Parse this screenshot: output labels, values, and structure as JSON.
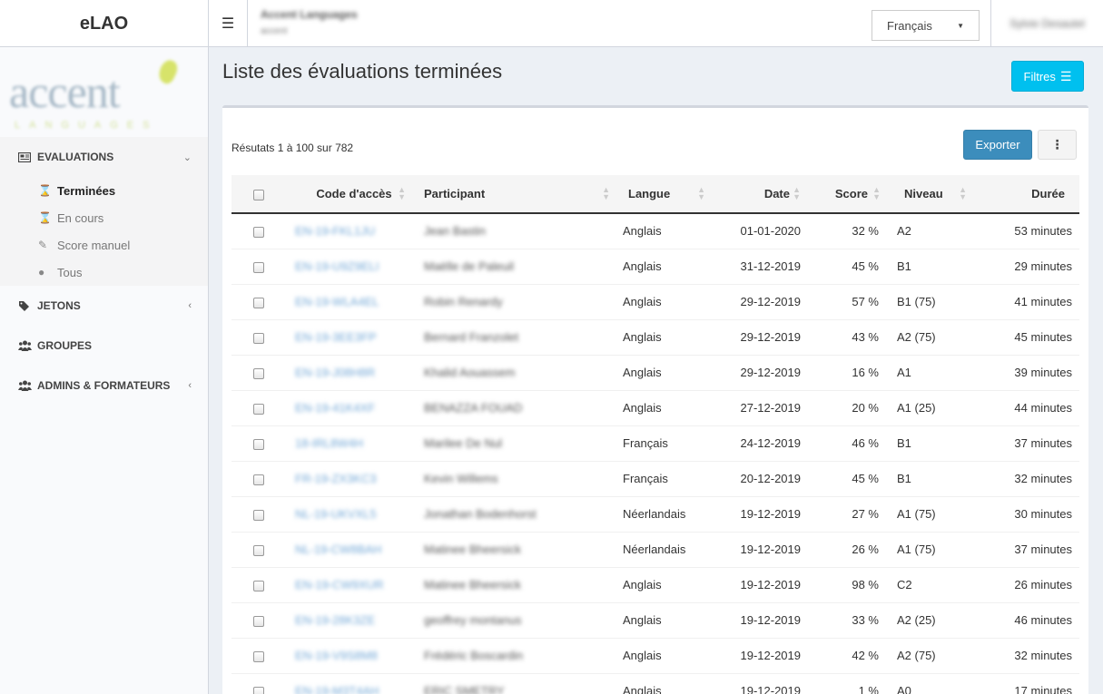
{
  "header": {
    "brand": "eLAO",
    "menu_icon": "hamburger-icon",
    "org_name": "Accent Languages",
    "org_sub": "accent",
    "language": "Français",
    "user": "Sylvie Desautel"
  },
  "sidebar": {
    "logo_word": "accent",
    "logo_sub": "LANGUAGES",
    "menu": {
      "evaluations": "EVALUATIONS",
      "jetons": "JETONS",
      "groupes": "GROUPES",
      "admins": "ADMINS & FORMATEURS"
    },
    "submenu": {
      "terminees": "Terminées",
      "en_cours": "En cours",
      "score_manuel": "Score manuel",
      "tous": "Tous"
    }
  },
  "main": {
    "title": "Liste des évaluations terminées",
    "filters_label": "Filtres",
    "results_text": "Résutats 1 à 100 sur 782",
    "export_label": "Exporter",
    "more_label": "⋮",
    "columns": {
      "code": "Code d'accès",
      "participant": "Participant",
      "langue": "Langue",
      "date": "Date",
      "score": "Score",
      "niveau": "Niveau",
      "duree": "Durée"
    },
    "rows": [
      {
        "code": "EN-19-FKL1JU",
        "participant": "Jean Bastin",
        "langue": "Anglais",
        "date": "01-01-2020",
        "score": "32 %",
        "niveau": "A2",
        "duree": "53 minutes"
      },
      {
        "code": "EN-19-U9Z9ELI",
        "participant": "Maëlle de Paleuil",
        "langue": "Anglais",
        "date": "31-12-2019",
        "score": "45 %",
        "niveau": "B1",
        "duree": "29 minutes"
      },
      {
        "code": "EN-19-WLA4EL",
        "participant": "Robin Renardy",
        "langue": "Anglais",
        "date": "29-12-2019",
        "score": "57 %",
        "niveau": "B1 (75)",
        "duree": "41 minutes"
      },
      {
        "code": "EN-19-3EE3FP",
        "participant": "Bernard Franzolet",
        "langue": "Anglais",
        "date": "29-12-2019",
        "score": "43 %",
        "niveau": "A2 (75)",
        "duree": "45 minutes"
      },
      {
        "code": "EN-19-J08H8R",
        "participant": "Khalid Aouassem",
        "langue": "Anglais",
        "date": "29-12-2019",
        "score": "16 %",
        "niveau": "A1",
        "duree": "39 minutes"
      },
      {
        "code": "EN-19-41K4XF",
        "participant": "BENAZZA FOUAD",
        "langue": "Anglais",
        "date": "27-12-2019",
        "score": "20 %",
        "niveau": "A1 (25)",
        "duree": "44 minutes"
      },
      {
        "code": "18-IRL8W4H",
        "participant": "Marilee De Nul",
        "langue": "Français",
        "date": "24-12-2019",
        "score": "46 %",
        "niveau": "B1",
        "duree": "37 minutes"
      },
      {
        "code": "FR-19-ZX3KC3",
        "participant": "Kevin Willems",
        "langue": "Français",
        "date": "20-12-2019",
        "score": "45 %",
        "niveau": "B1",
        "duree": "32 minutes"
      },
      {
        "code": "NL-19-UKVXL5",
        "participant": "Jonathan Bodenhorst",
        "langue": "Néerlandais",
        "date": "19-12-2019",
        "score": "27 %",
        "niveau": "A1 (75)",
        "duree": "30 minutes"
      },
      {
        "code": "NL-19-CW8BAH",
        "participant": "Matinee Bheersick",
        "langue": "Néerlandais",
        "date": "19-12-2019",
        "score": "26 %",
        "niveau": "A1 (75)",
        "duree": "37 minutes"
      },
      {
        "code": "EN-19-CW9XUR",
        "participant": "Matinee Bheersick",
        "langue": "Anglais",
        "date": "19-12-2019",
        "score": "98 %",
        "niveau": "C2",
        "duree": "26 minutes"
      },
      {
        "code": "EN-19-28K3ZE",
        "participant": "geoffrey montanus",
        "langue": "Anglais",
        "date": "19-12-2019",
        "score": "33 %",
        "niveau": "A2 (25)",
        "duree": "46 minutes"
      },
      {
        "code": "EN-19-V9S8M8",
        "participant": "Frédéric Boscardin",
        "langue": "Anglais",
        "date": "19-12-2019",
        "score": "42 %",
        "niveau": "A2 (75)",
        "duree": "32 minutes"
      },
      {
        "code": "EN-19-M3T4AH",
        "participant": "ERIC SMETRY",
        "langue": "Anglais",
        "date": "19-12-2019",
        "score": "1 %",
        "niveau": "A0",
        "duree": "17 minutes"
      }
    ]
  },
  "colors": {
    "accent_info": "#00c0ef",
    "primary": "#3c8dbc",
    "background": "#ecf0f5"
  }
}
